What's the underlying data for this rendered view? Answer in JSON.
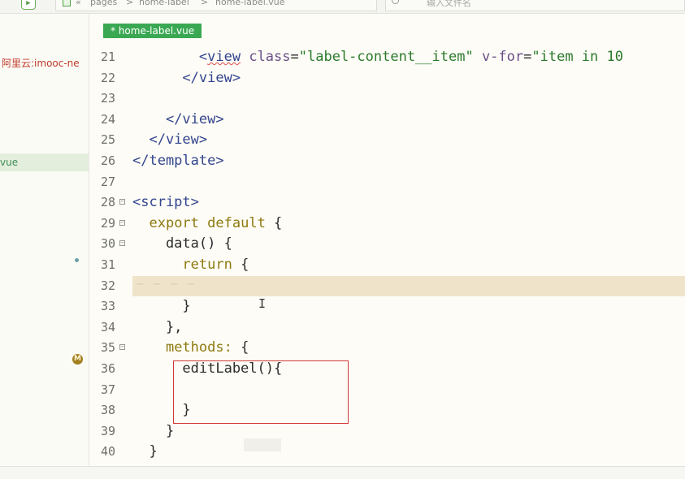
{
  "toolbar": {
    "breadcrumb": [
      "«",
      "pages",
      ">",
      "home-label",
      ">",
      "home-label.vue"
    ],
    "search_placeholder": "输入文件名"
  },
  "sidebar": {
    "project_label": "阿里云:imooc-ne",
    "active_file_label": "vue"
  },
  "editor": {
    "tab_label": "* home-label.vue",
    "lines": [
      {
        "num": "21",
        "segments": [
          {
            "t": "        ",
            "c": "plain"
          },
          {
            "t": "<view",
            "c": "tag squiggle-partial"
          },
          {
            "t": " class",
            "c": "attr"
          },
          {
            "t": "=",
            "c": "plain"
          },
          {
            "t": "\"label-content__item\"",
            "c": "str"
          },
          {
            "t": " v-for",
            "c": "attr"
          },
          {
            "t": "=",
            "c": "plain"
          },
          {
            "t": "\"item in 10",
            "c": "str"
          }
        ]
      },
      {
        "num": "22",
        "segments": [
          {
            "t": "      ",
            "c": "plain"
          },
          {
            "t": "</view>",
            "c": "tag"
          }
        ]
      },
      {
        "num": "23",
        "segments": []
      },
      {
        "num": "24",
        "segments": [
          {
            "t": "    ",
            "c": "plain"
          },
          {
            "t": "</view>",
            "c": "tag"
          }
        ]
      },
      {
        "num": "25",
        "segments": [
          {
            "t": "  ",
            "c": "plain"
          },
          {
            "t": "</view>",
            "c": "tag"
          }
        ]
      },
      {
        "num": "26",
        "segments": [
          {
            "t": "</template>",
            "c": "tag"
          }
        ]
      },
      {
        "num": "27",
        "segments": []
      },
      {
        "num": "28",
        "fold": true,
        "segments": [
          {
            "t": "<script>",
            "c": "tag"
          }
        ]
      },
      {
        "num": "29",
        "fold": true,
        "segments": [
          {
            "t": "  ",
            "c": "plain"
          },
          {
            "t": "export",
            "c": "kw"
          },
          {
            "t": " ",
            "c": "plain"
          },
          {
            "t": "default",
            "c": "kw"
          },
          {
            "t": " {",
            "c": "plain"
          }
        ]
      },
      {
        "num": "30",
        "fold": true,
        "segments": [
          {
            "t": "    data() {",
            "c": "fn"
          }
        ]
      },
      {
        "num": "31",
        "segments": [
          {
            "t": "      ",
            "c": "plain"
          },
          {
            "t": "return",
            "c": "kw"
          },
          {
            "t": " {",
            "c": "plain"
          }
        ]
      },
      {
        "num": "32",
        "segments": []
      },
      {
        "num": "33",
        "segments": [
          {
            "t": "      }",
            "c": "plain"
          }
        ]
      },
      {
        "num": "34",
        "segments": [
          {
            "t": "    },",
            "c": "plain"
          }
        ]
      },
      {
        "num": "35",
        "fold": true,
        "segments": [
          {
            "t": "    ",
            "c": "plain"
          },
          {
            "t": "methods:",
            "c": "kw"
          },
          {
            "t": " {",
            "c": "plain"
          }
        ]
      },
      {
        "num": "36",
        "segments": [
          {
            "t": "      editLabel(){",
            "c": "fn"
          }
        ]
      },
      {
        "num": "37",
        "segments": []
      },
      {
        "num": "38",
        "segments": [
          {
            "t": "      }",
            "c": "plain"
          }
        ]
      },
      {
        "num": "39",
        "segments": [
          {
            "t": "    }",
            "c": "plain"
          }
        ]
      },
      {
        "num": "40",
        "segments": [
          {
            "t": "  }",
            "c": "plain"
          }
        ]
      }
    ],
    "current_line_dashes": "— — — —",
    "cursor_glyph": "I",
    "marker_m": "M"
  }
}
